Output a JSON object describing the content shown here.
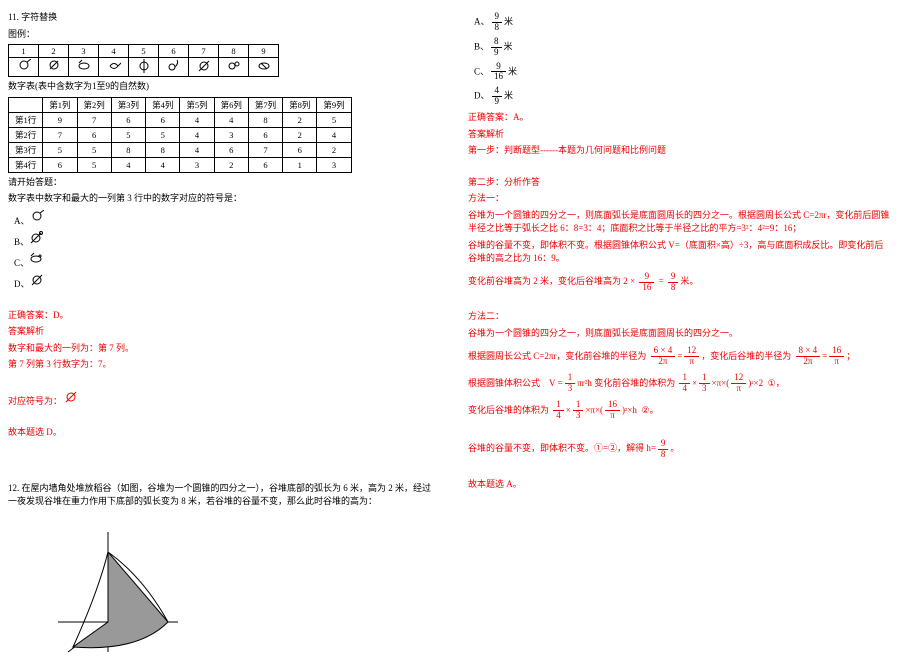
{
  "left": {
    "q11_title": "11. 字符替换",
    "legend_label": "图例：",
    "legend_header": [
      "1",
      "2",
      "3",
      "4",
      "5",
      "6",
      "7",
      "8",
      "9"
    ],
    "legend_symbols": [
      "𝄞a",
      "𝄞b",
      "𝄞c",
      "𝄞d",
      "𝄞e",
      "𝄞f",
      "𝄞g",
      "𝄞h",
      "𝄞i"
    ],
    "table_caption": "数字表(表中含数字为1至9的自然数)",
    "num_table_header": [
      "",
      "第1列",
      "第2列",
      "第3列",
      "第4列",
      "第5列",
      "第6列",
      "第7列",
      "第8列",
      "第9列"
    ],
    "num_table_rows": [
      [
        "第1行",
        "9",
        "7",
        "6",
        "6",
        "4",
        "4",
        "8",
        "2",
        "5"
      ],
      [
        "第2行",
        "7",
        "6",
        "5",
        "5",
        "4",
        "3",
        "6",
        "2",
        "4"
      ],
      [
        "第3行",
        "5",
        "5",
        "8",
        "8",
        "4",
        "6",
        "7",
        "6",
        "2"
      ],
      [
        "第4行",
        "6",
        "5",
        "4",
        "4",
        "3",
        "2",
        "6",
        "1",
        "3"
      ]
    ],
    "begin_text": "请开始答题：",
    "question_text": "数字表中数字和最大的一列第 3 行中的数字对应的符号是：",
    "optA": "A、",
    "optB": "B、",
    "optC": "C、",
    "optD": "D、",
    "correct": "正确答案：D。",
    "analysis_label": "答案解析",
    "analysis_1": "数字和最大的一列为：第 7 列。",
    "analysis_2": "第 7 列第 3 行数字为：7。",
    "analysis_3": "对应符号为：",
    "analysis_4": "故本题选 D。",
    "q12_text": "12. 在屋内墙角处堆放稻谷（如图，谷堆为一个圆锥的四分之一），谷堆底部的弧长为 6 米，高为 2 米，经过一夜发现谷堆在重力作用下底部的弧长变为 8 米，若谷堆的谷量不变，那么此时谷堆的高为："
  },
  "right": {
    "optA_pre": "A、",
    "optA_frac_n": "9",
    "optA_frac_d": "8",
    "optA_post": "米",
    "optB_pre": "B、",
    "optB_frac_n": "8",
    "optB_frac_d": "9",
    "optB_post": "米",
    "optC_pre": "C、",
    "optC_frac_n": "9",
    "optC_frac_d": "16",
    "optC_post": "米",
    "optD_pre": "D、",
    "optD_frac_n": "4",
    "optD_frac_d": "9",
    "optD_post": "米",
    "correct": "正确答案：A。",
    "analysis_label": "答案解析",
    "step1": "第一步：判断题型------本题为几何问题和比例问题",
    "step2": "第二步：分析作答",
    "method1_label": "方法一：",
    "m1_line1": "谷堆为一个圆锥的四分之一，则底面弧长是底面圆周长的四分之一。根据圆周长公式 C=2πr，变化前后圆锥半径之比等于弧长之比 6：8=3：4；底面积之比等于半径之比的平方=3²：4²=9：16；",
    "m1_line2": "谷堆的谷量不变，即体积不变。根据圆锥体积公式 V=（底面积×高）÷3，高与底面积成反比。即变化前后谷堆的高之比为 16：9。",
    "m1_line3_pre": "变化前谷堆高为 2 米，变化后谷堆高为",
    "m1_eq_2": "2",
    "m1_eq_x": "×",
    "m1_eq_9": "9",
    "m1_eq_16": "16",
    "m1_eq_eq": "=",
    "m1_eq_r9": "9",
    "m1_eq_r8": "8",
    "m1_post_unit": "米。",
    "method2_label": "方法二：",
    "m2_line1": "谷堆为一个圆锥的四分之一，则底面弧长是底面圆周长的四分之一。",
    "m2_line2_pre": "根据圆周长公式 C=2πr，变化前谷堆的半径为",
    "m2_64n": "6 × 4",
    "m2_64d": "2π",
    "m2_12n": "12",
    "m2_12d": "π",
    "m2_mid": "，变化后谷堆的半径为",
    "m2_84n": "8 × 4",
    "m2_84d": "2π",
    "m2_16n": "16",
    "m2_16d": "π",
    "m2_end": "；",
    "cone_label": "根据圆锥体积公式",
    "cone_eq": "V = ",
    "cone_13n": "1",
    "cone_13d": "3",
    "cone_rest": "πr²h",
    "before_label": "变化前谷堆的体积为",
    "b_14n": "1",
    "b_14d": "4",
    "b_x1": "×",
    "b_13n": "1",
    "b_13d": "3",
    "b_x2": "×",
    "b_pi": "π",
    "b_x3": "×",
    "b_12n": "12",
    "b_12d": "π",
    "b_sq": "²",
    "b_x4": "×",
    "b_2": "2",
    "b_mark": "①",
    "b_comma": "，",
    "after_label": "变化后谷堆的体积为",
    "a_14n": "1",
    "a_14d": "4",
    "a_x1": "×",
    "a_13n": "1",
    "a_13d": "3",
    "a_x2": "×",
    "a_pi": "π",
    "a_x3": "×",
    "a_16n": "16",
    "a_16d": "π",
    "a_sq": "²",
    "a_x4": "×",
    "a_h": "h",
    "a_mark": "②",
    "a_comma": "。",
    "final_pre": "谷堆的谷量不变，即体积不变。①=②，解得 h=",
    "final_n": "9",
    "final_d": "8",
    "final_post": "。",
    "final_conc": "故本题选 A。"
  }
}
